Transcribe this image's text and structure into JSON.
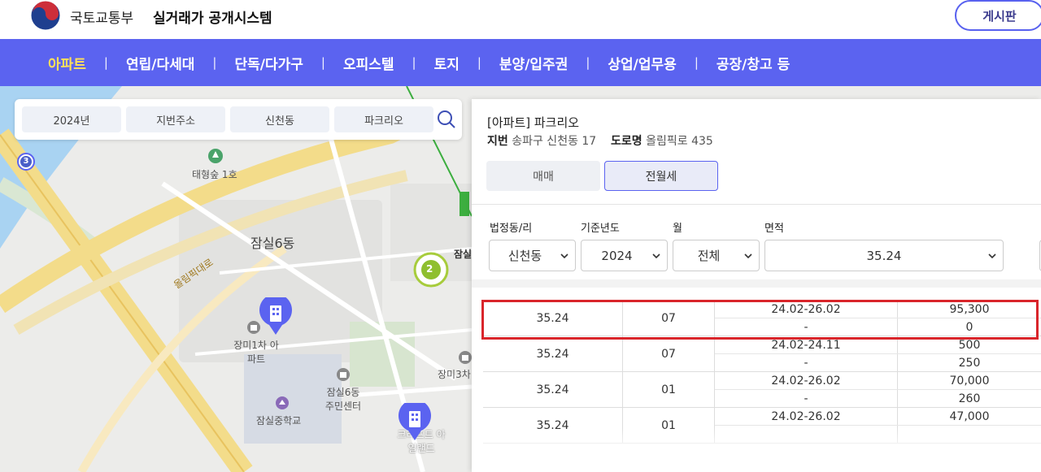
{
  "header": {
    "ministry": "국토교통부",
    "system_name": "실거래가 공개시스템",
    "board_label": "게시판"
  },
  "nav": {
    "items": [
      "아파트",
      "연립/다세대",
      "단독/다가구",
      "오피스텔",
      "토지",
      "분양/입주권",
      "상업/업무용",
      "공장/창고 등"
    ],
    "active": "아파트"
  },
  "filter": {
    "year": "2024년",
    "address_type": "지번주소",
    "dong": "신천동",
    "complex": "파크리오"
  },
  "map": {
    "labels": {
      "forest": "태형숲 1호",
      "district": "잠실6동",
      "road": "올림픽대로",
      "apt1": "장미1차 아파트",
      "center": "잠실6동 주민센터",
      "school": "잠실중학교",
      "apt3": "장미3차",
      "island": "크리프트 아일랜드",
      "cluster_count": "2",
      "badge_3": "3",
      "cut_label": "잠실"
    }
  },
  "panel": {
    "title": "[아파트] 파크리오",
    "jibun_label": "지번",
    "jibun": "송파구 신천동 17",
    "road_label": "도로명",
    "road": "올림픽로 435",
    "tabs": {
      "sale": "매매",
      "rent": "전월세"
    },
    "active_tab": "전월세",
    "filters": {
      "dong_label": "법정동/리",
      "dong_value": "신천동",
      "year_label": "기준년도",
      "year_value": "2024",
      "month_label": "월",
      "month_value": "전체",
      "area_label": "면적",
      "area_value": "35.24"
    },
    "rows": [
      {
        "area": "35.24",
        "month": "07",
        "period": "24.02-26.02",
        "period2": "-",
        "deposit": "95,300",
        "rent": "0",
        "highlighted": true
      },
      {
        "area": "35.24",
        "month": "07",
        "period": "24.02-24.11",
        "period2": "-",
        "deposit": "500",
        "rent": "250"
      },
      {
        "area": "35.24",
        "month": "01",
        "period": "24.02-26.02",
        "period2": "-",
        "deposit": "70,000",
        "rent": "260"
      },
      {
        "area": "35.24",
        "month": "01",
        "period": "24.02-26.02",
        "period2": "",
        "deposit": "47,000",
        "rent": ""
      }
    ]
  },
  "colors": {
    "nav_bg": "#5b63f0",
    "nav_active": "#ffe15a",
    "highlight_border": "#d9252b",
    "marker": "#5b63f0"
  }
}
